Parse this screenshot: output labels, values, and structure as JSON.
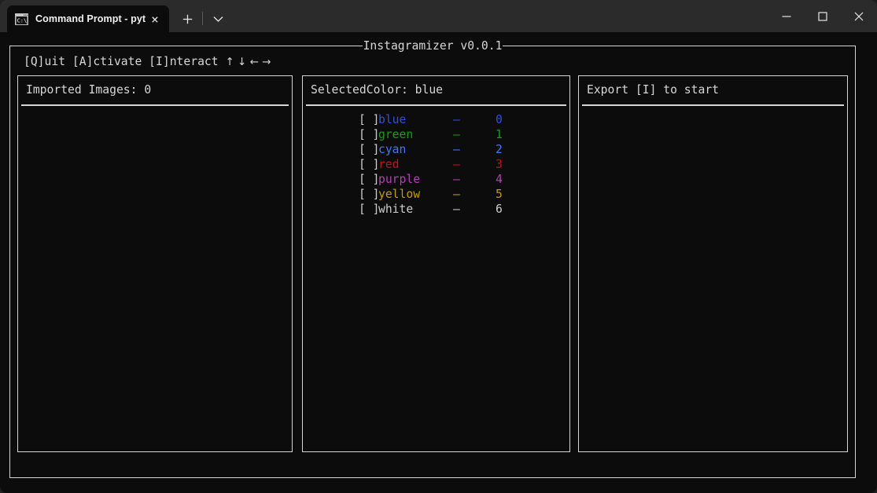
{
  "window": {
    "tab": {
      "title": "Command Prompt - python (",
      "icon": "cmd-prompt-icon",
      "close_label": "×"
    },
    "new_tab_label": "+",
    "tab_dropdown_label": "⌄",
    "controls": {
      "minimize_label": "—",
      "maximize_label": "□",
      "close_label": "✕"
    }
  },
  "app": {
    "title": "Instagramizer v0.0.1",
    "menubar": "[Q]uit [A]ctivate [I]nteract ",
    "menubar_arrows": "↑ ↓ ← →"
  },
  "panels": {
    "left": {
      "header": "Imported Images: 0"
    },
    "middle": {
      "header": "SelectedColor: blue",
      "rows": [
        {
          "box": "[ ]",
          "name": "blue",
          "dash": "–",
          "index": "0",
          "color": "#2f4fdb"
        },
        {
          "box": "[ ]",
          "name": "green",
          "dash": "–",
          "index": "1",
          "color": "#13a10e"
        },
        {
          "box": "[ ]",
          "name": "cyan",
          "dash": "–",
          "index": "2",
          "color": "#3b78ff"
        },
        {
          "box": "[ ]",
          "name": "red",
          "dash": "–",
          "index": "3",
          "color": "#c50f1f"
        },
        {
          "box": "[ ]",
          "name": "purple",
          "dash": "–",
          "index": "4",
          "color": "#b43fb4"
        },
        {
          "box": "[ ]",
          "name": "yellow",
          "dash": "–",
          "index": "5",
          "color": "#c19c00"
        },
        {
          "box": "[ ]",
          "name": "white",
          "dash": "–",
          "index": "6",
          "color": "#cccccc"
        }
      ]
    },
    "right": {
      "header": "Export [I] to start"
    }
  },
  "theme": {
    "terminal_bg": "#0c0c0c",
    "border": "#d6d6d6",
    "foreground": "#cccccc",
    "titlebar_bg": "#2b2b2b"
  }
}
